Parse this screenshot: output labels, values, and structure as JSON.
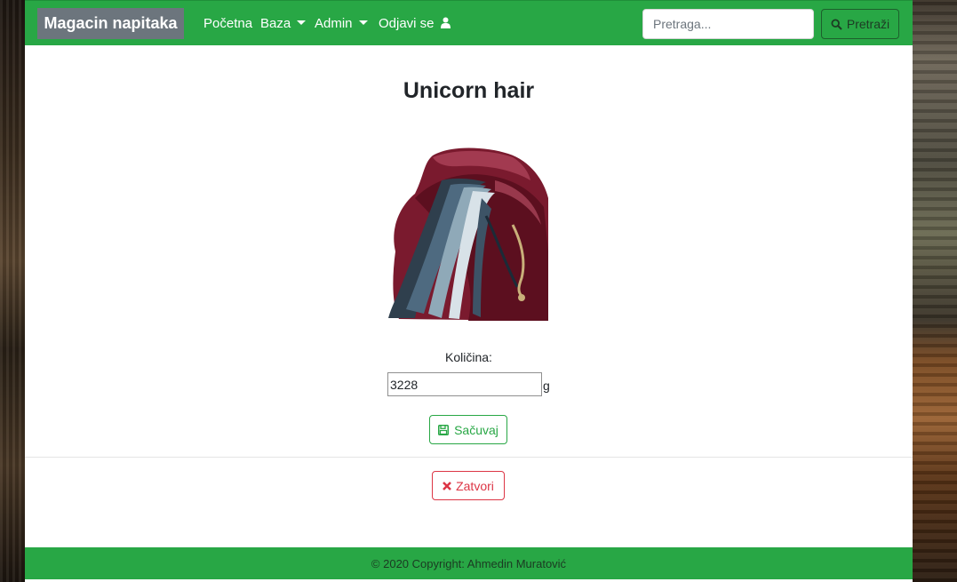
{
  "navbar": {
    "brand": "Magacin napitaka",
    "items": [
      {
        "label": "Početna"
      },
      {
        "label": "Baza"
      },
      {
        "label": "Admin"
      },
      {
        "label": "Odjavi se"
      }
    ],
    "search_placeholder": "Pretraga...",
    "search_button": "Pretraži",
    "color": "#28a745"
  },
  "item": {
    "title": "Unicorn hair",
    "quantity_label": "Količina:",
    "quantity_value": "3228",
    "unit": "g"
  },
  "actions": {
    "save_label": "Sačuvaj",
    "close_label": "Zatvori"
  },
  "footer": {
    "text": "© 2020 Copyright: Ahmedin Muratović"
  },
  "icons": [
    "caret-down-icon",
    "user-icon",
    "search-icon",
    "save-icon",
    "close-icon"
  ]
}
